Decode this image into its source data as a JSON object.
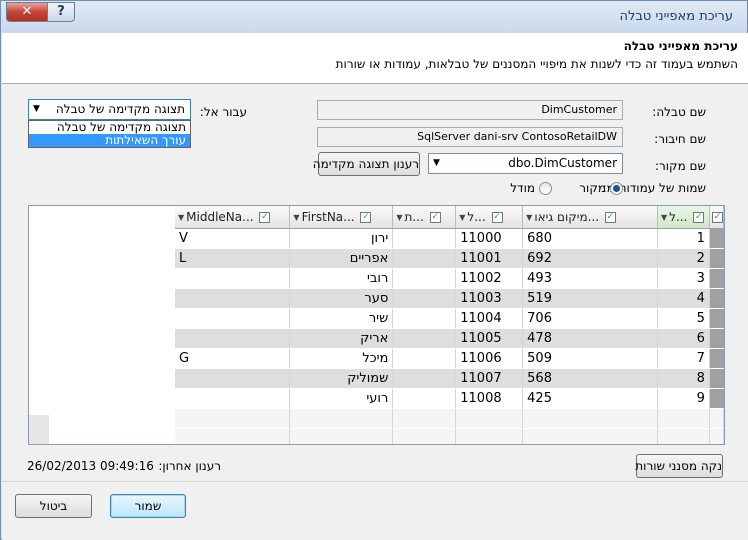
{
  "window": {
    "title": "עריכת מאפייני טבלה",
    "help_label": "?",
    "close_label": "✕"
  },
  "header": {
    "title": "עריכת מאפייני טבלה",
    "description": "השתמש בעמוד זה כדי לשנות את מיפויי המסננים של טבלאות, עמודות או שורות"
  },
  "form": {
    "table_name_label": "שם טבלה:",
    "table_name_value": "DimCustomer",
    "connection_label": "שם חיבור:",
    "connection_value": "SqlServer dani-srv ContosoRetailDW",
    "source_label": "שם מקור:",
    "source_value": "dbo.DimCustomer",
    "switch_to_label": "עבור אל:",
    "switch_to_selected": "תצוגה מקדימה של טבלה",
    "switch_to_options": [
      "תצוגה מקדימה של טבלה",
      "עורך השאילתות"
    ],
    "refresh_preview_button": "רענון תצוגה מקדימה",
    "column_names_from_label": "שמות של עמודות מ:",
    "radio_source_label": "מקור",
    "radio_model_label": "מודל",
    "radio_selected": "מקור"
  },
  "grid": {
    "columns": [
      "ל...",
      "מיקום גיאו...",
      "ל...",
      "ת...",
      "FirstNa...",
      "MiddleNa..."
    ],
    "rows": [
      {
        "id": "1",
        "geo": "680",
        "key": "11000",
        "t": "",
        "first": "ירון",
        "middle": "V"
      },
      {
        "id": "2",
        "geo": "692",
        "key": "11001",
        "t": "",
        "first": "אפריים",
        "middle": "L"
      },
      {
        "id": "3",
        "geo": "493",
        "key": "11002",
        "t": "",
        "first": "רובי",
        "middle": ""
      },
      {
        "id": "4",
        "geo": "519",
        "key": "11003",
        "t": "",
        "first": "סער",
        "middle": ""
      },
      {
        "id": "5",
        "geo": "706",
        "key": "11004",
        "t": "",
        "first": "שיר",
        "middle": ""
      },
      {
        "id": "6",
        "geo": "478",
        "key": "11005",
        "t": "",
        "first": "אריק",
        "middle": ""
      },
      {
        "id": "7",
        "geo": "509",
        "key": "11006",
        "t": "",
        "first": "מיכל",
        "middle": "G"
      },
      {
        "id": "8",
        "geo": "568",
        "key": "11007",
        "t": "",
        "first": "שמוליק",
        "middle": ""
      },
      {
        "id": "9",
        "geo": "425",
        "key": "11008",
        "t": "",
        "first": "רועי",
        "middle": ""
      }
    ]
  },
  "status": {
    "last_refresh_label": "רענון אחרון:",
    "last_refresh_value": "26/02/2013 09:49:16",
    "clear_filters_button": "נקה מסנני שורות"
  },
  "footer": {
    "save_button": "שמור",
    "cancel_button": "ביטול"
  }
}
